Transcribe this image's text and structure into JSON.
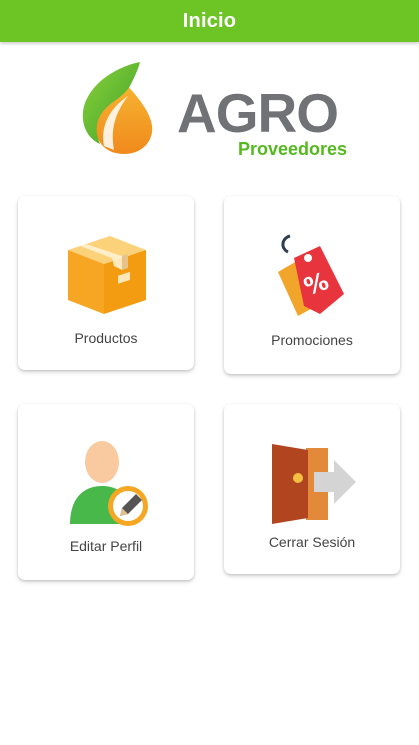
{
  "app_bar": {
    "title": "Inicio",
    "color": "#6cc425"
  },
  "logo": {
    "word": "AGRO",
    "subtitle": "Proveedores",
    "word_color": "#707276",
    "subtitle_color": "#56b81f"
  },
  "menu": [
    {
      "label": "Productos",
      "icon": "box-icon"
    },
    {
      "label": "Promociones",
      "icon": "tag-percent-icon"
    },
    {
      "label": "Editar Perfil",
      "icon": "user-edit-icon"
    },
    {
      "label": "Cerrar Sesión",
      "icon": "logout-door-icon"
    }
  ]
}
